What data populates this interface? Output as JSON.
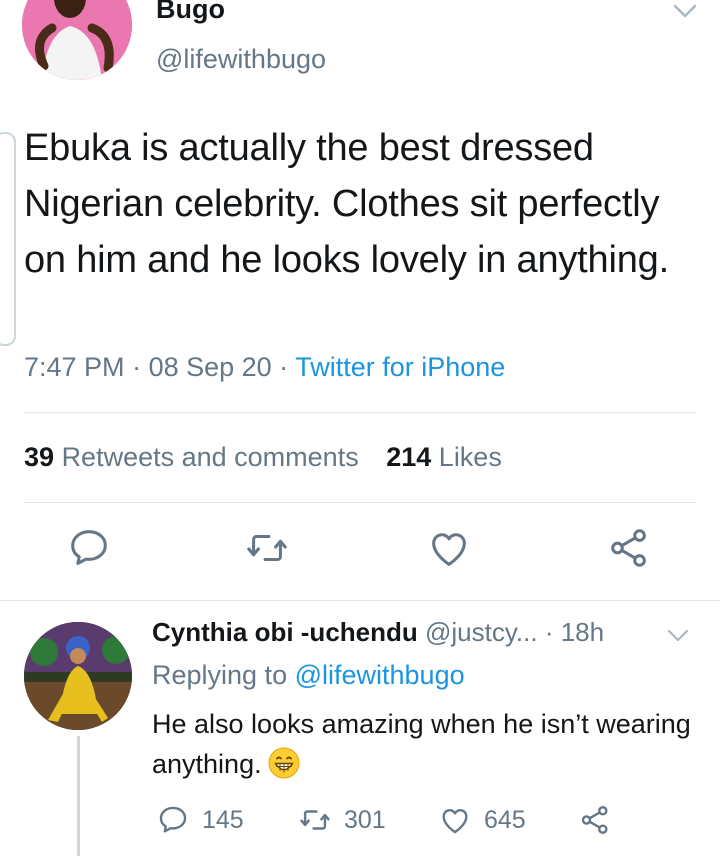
{
  "main_tweet": {
    "display_name": "Bugo",
    "handle": "@lifewithbugo",
    "text": "Ebuka is actually the best dressed Nigerian celebrity. Clothes sit perfectly on him and he looks lovely in anything.",
    "time": "7:47 PM",
    "separator1": " · ",
    "date": "08 Sep 20",
    "separator2": " · ",
    "source": "Twitter for iPhone",
    "retweets_count": "39",
    "retweets_label": "Retweets and comments",
    "likes_count": "214",
    "likes_label": "Likes"
  },
  "reply": {
    "display_name": "Cynthia obi -uchendu",
    "handle": "@justcy...",
    "dot": " · ",
    "time": "18h",
    "replying_prefix": "Replying to ",
    "replying_handle": "@lifewithbugo",
    "text": "He also looks amazing when he isn’t wearing anything.",
    "reply_count": "145",
    "retweet_count": "301",
    "like_count": "645"
  },
  "icons": {
    "caret": "chevron-down-icon",
    "reply": "speech-bubble-icon",
    "retweet": "retweet-icon",
    "like": "heart-icon",
    "share": "share-icon",
    "emoji": "grinning-face-icon"
  },
  "colors": {
    "link": "#1b95e0",
    "muted": "#657786",
    "text": "#14171a",
    "divider": "#e1e8ed"
  }
}
